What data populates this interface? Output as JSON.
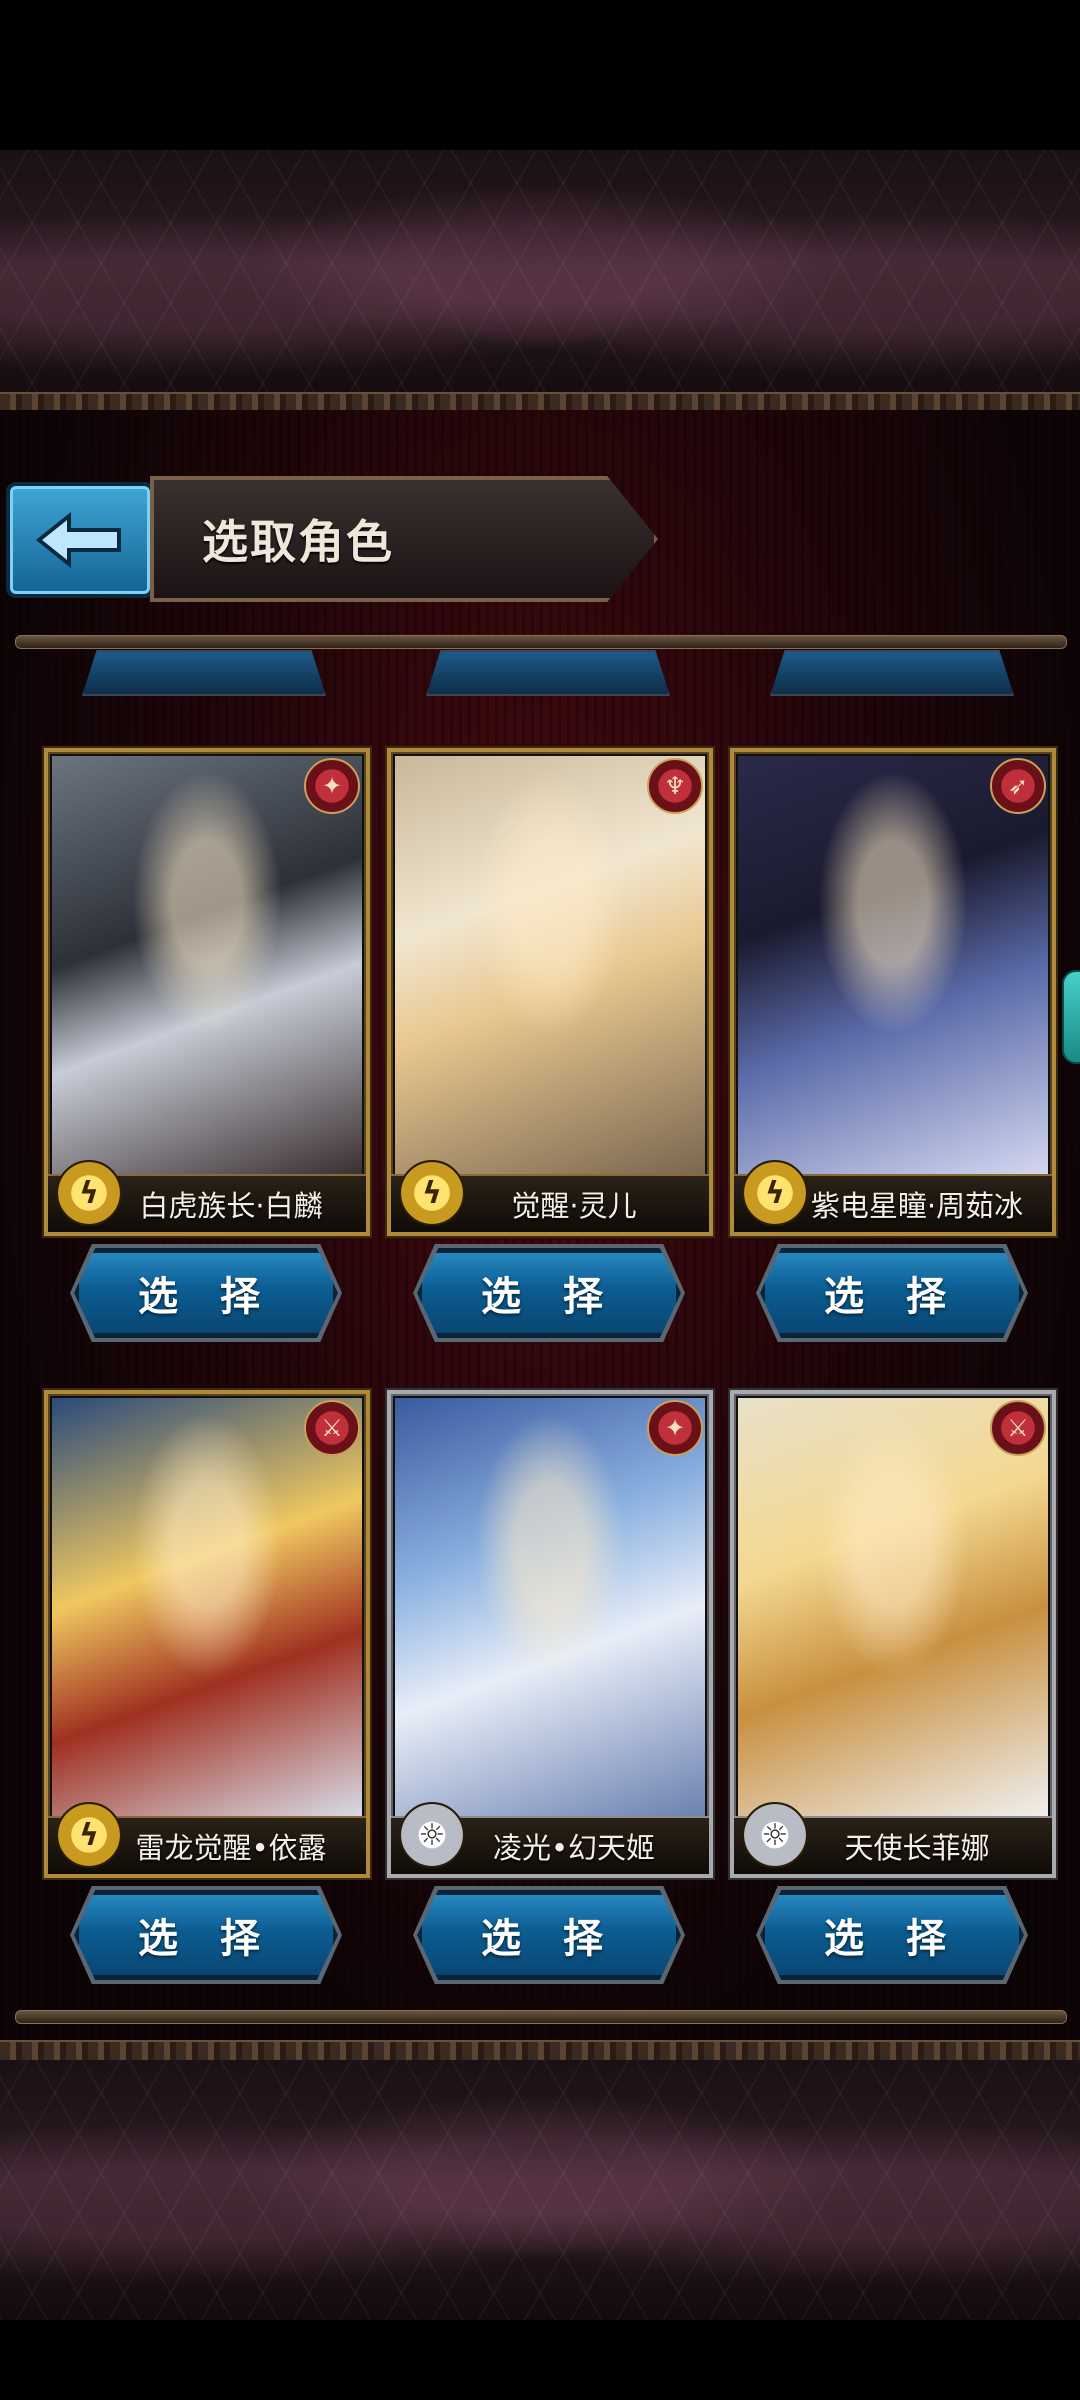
{
  "header": {
    "title": "选取角色"
  },
  "characters": [
    {
      "name": "白虎族长·白麟",
      "frame": "gold",
      "element": "thunder",
      "badge": "shuriken",
      "button": "选 择"
    },
    {
      "name": "觉醒·灵儿",
      "frame": "gold",
      "element": "thunder",
      "badge": "flame",
      "button": "选 择"
    },
    {
      "name": "紫电星瞳·周茹冰",
      "frame": "gold",
      "element": "thunder",
      "badge": "bow",
      "button": "选 择"
    },
    {
      "name": "雷龙觉醒•依露",
      "frame": "gold",
      "element": "thunder",
      "badge": "sword",
      "button": "选 择"
    },
    {
      "name": "凌光•幻天姬",
      "frame": "silver",
      "element": "light",
      "badge": "shuriken",
      "button": "选 择"
    },
    {
      "name": "天使长菲娜",
      "frame": "silver",
      "element": "light",
      "badge": "sword",
      "button": "选 择"
    }
  ],
  "icons": {
    "back": "arrow-left-icon",
    "thunder": "lightning-icon",
    "light": "sun-icon"
  },
  "colors": {
    "button_blue": "#146394",
    "gold_frame": "#b08a3a",
    "silver_frame": "#a8aab0"
  }
}
